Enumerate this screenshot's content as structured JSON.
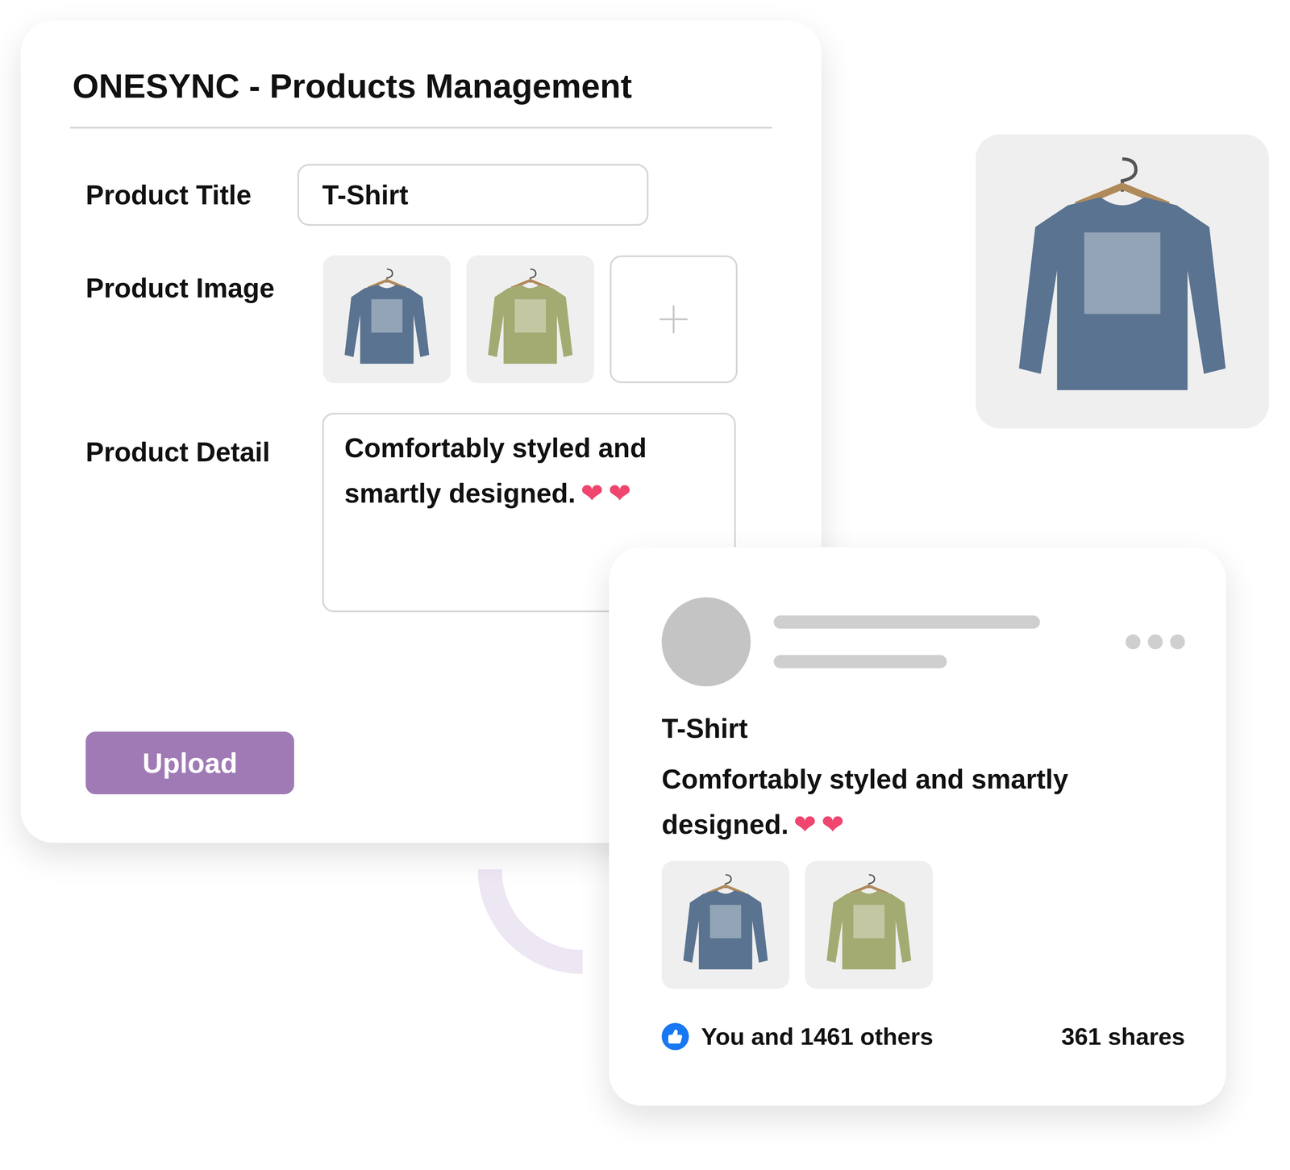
{
  "editor": {
    "title": "ONESYNC - Products Management",
    "title_label": "Product Title",
    "title_value": "T-Shirt",
    "image_label": "Product Image",
    "images": [
      {
        "color": "#5a7391"
      },
      {
        "color": "#a3ab72"
      }
    ],
    "detail_label": "Product Detail",
    "detail_text": "Comfortably styled and smartly designed.",
    "detail_hearts": [
      "❤",
      "❤"
    ],
    "upload_button": "Upload"
  },
  "preview": {
    "color": "#5a7391"
  },
  "post": {
    "title": "T-Shirt",
    "text": "Comfortably styled and smartly designed.",
    "hearts": [
      "❤",
      "❤"
    ],
    "images": [
      {
        "color": "#5a7391"
      },
      {
        "color": "#a3ab72"
      }
    ],
    "liked": true,
    "likes": "You and 1461 others",
    "shares": "361 shares"
  }
}
